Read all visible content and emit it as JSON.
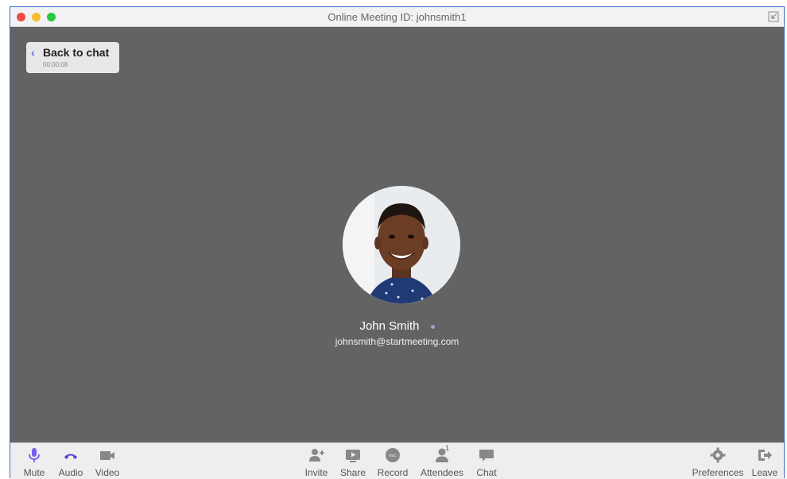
{
  "window": {
    "title": "Online Meeting ID: johnsmith1"
  },
  "back": {
    "label": "Back to chat",
    "timer": "00:00:08"
  },
  "participant": {
    "name": "John Smith",
    "email": "johnsmith@startmeeting.com"
  },
  "toolbar": {
    "mute": "Mute",
    "audio": "Audio",
    "video": "Video",
    "invite": "Invite",
    "share": "Share",
    "record": "Record",
    "attendees": "Attendees",
    "attendees_count": "1",
    "chat": "Chat",
    "preferences": "Preferences",
    "leave": "Leave"
  },
  "colors": {
    "accent": "#7b5cf0",
    "stage": "#636363",
    "toolbar": "#eeeeee"
  },
  "icons": [
    "microphone-icon",
    "phone-icon",
    "camera-icon",
    "add-user-icon",
    "share-screen-icon",
    "record-icon",
    "attendees-icon",
    "chat-icon",
    "gear-icon",
    "leave-icon"
  ]
}
